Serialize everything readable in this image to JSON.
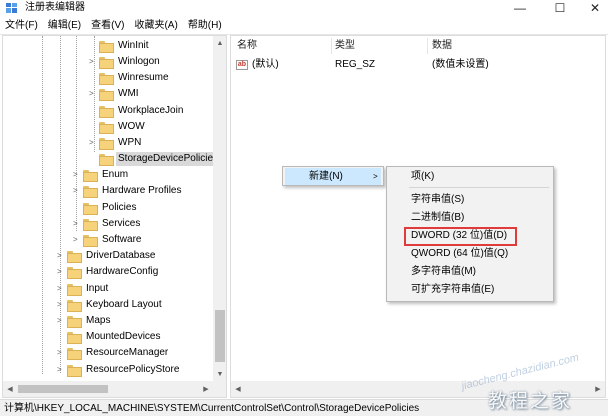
{
  "window": {
    "title": "注册表编辑器",
    "minimize_glyph": "—",
    "maximize_glyph": "☐",
    "close_glyph": "✕"
  },
  "menu": [
    "文件(F)",
    "编辑(E)",
    "查看(V)",
    "收藏夹(A)",
    "帮助(H)"
  ],
  "tree": {
    "nodes": [
      {
        "label": "WinInit",
        "expandable": false
      },
      {
        "label": "Winlogon",
        "expandable": true
      },
      {
        "label": "Winresume",
        "expandable": false
      },
      {
        "label": "WMI",
        "expandable": true
      },
      {
        "label": "WorkplaceJoin",
        "expandable": false
      },
      {
        "label": "WOW",
        "expandable": false
      },
      {
        "label": "WPN",
        "expandable": true
      },
      {
        "label": "StorageDevicePolicies",
        "expandable": false,
        "selected": true
      },
      {
        "label": "Enum",
        "expandable": true
      },
      {
        "label": "Hardware Profiles",
        "expandable": true
      },
      {
        "label": "Policies",
        "expandable": false
      },
      {
        "label": "Services",
        "expandable": true
      },
      {
        "label": "Software",
        "expandable": true
      },
      {
        "label": "DriverDatabase",
        "expandable": true
      },
      {
        "label": "HardwareConfig",
        "expandable": true
      },
      {
        "label": "Input",
        "expandable": true
      },
      {
        "label": "Keyboard Layout",
        "expandable": true
      },
      {
        "label": "Maps",
        "expandable": true
      },
      {
        "label": "MountedDevices",
        "expandable": false
      },
      {
        "label": "ResourceManager",
        "expandable": true
      },
      {
        "label": "ResourcePolicyStore",
        "expandable": true
      }
    ]
  },
  "values_pane": {
    "columns": [
      "名称",
      "类型",
      "数据"
    ],
    "rows": [
      {
        "name": "(默认)",
        "type": "REG_SZ",
        "data": "(数值未设置)",
        "icon": "ab-string-icon"
      }
    ]
  },
  "context_menu": {
    "parent_item": "新建(N)",
    "submenu": [
      {
        "label": "项(K)"
      },
      {
        "label": "字符串值(S)"
      },
      {
        "label": "二进制值(B)"
      },
      {
        "label": "DWORD (32 位)值(D)",
        "boxed": true
      },
      {
        "label": "QWORD (64 位)值(Q)"
      },
      {
        "label": "多字符串值(M)"
      },
      {
        "label": "可扩充字符串值(E)"
      }
    ]
  },
  "status_bar": {
    "path": "计算机\\HKEY_LOCAL_MACHINE\\SYSTEM\\CurrentControlSet\\Control\\StorageDevicePolicies"
  },
  "watermark": {
    "url": "jiaocheng.chazidian.com",
    "text": "教程之家"
  },
  "colors": {
    "highlight": "#cce8ff",
    "red_box": "#e03b3b",
    "folder": "#f6d37a"
  }
}
